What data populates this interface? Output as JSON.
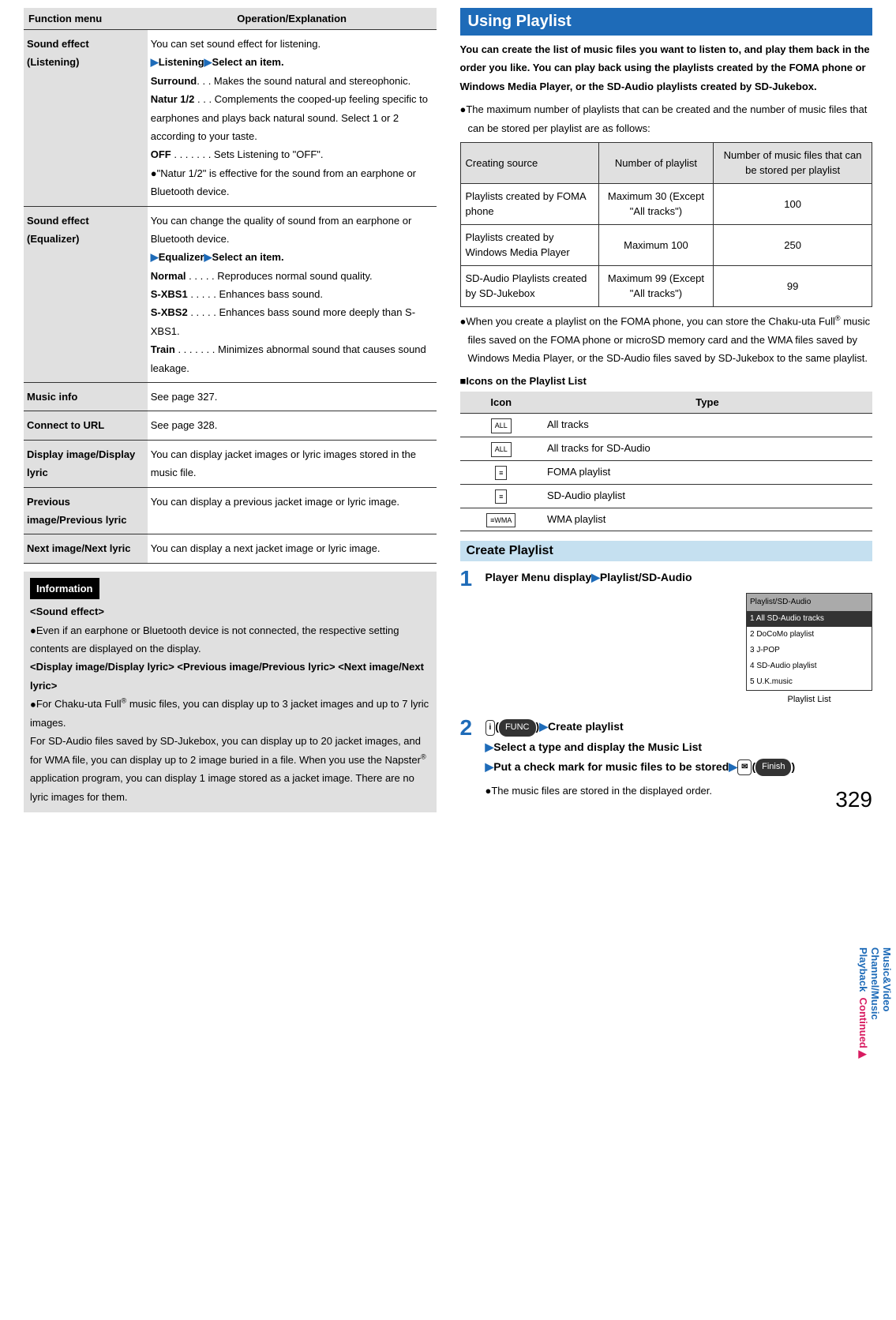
{
  "func_header_menu": "Function menu",
  "func_header_op": "Operation/Explanation",
  "rows": {
    "r1_menu": "Sound effect (Listening)",
    "r1_intro": "You can set sound effect for listening.",
    "r1_link": "Listening",
    "r1_sel": "Select an item.",
    "r1_surround_k": "Surround",
    "r1_surround_v": ". . . Makes the sound natural and stereophonic.",
    "r1_natur_k": "Natur 1/2",
    "r1_natur_v": " . . . Complements the cooped-up feeling specific to earphones and plays back natural sound. Select 1 or 2 according to your taste.",
    "r1_off_k": "OFF",
    "r1_off_v": " . . . . . . . Sets Listening to \"OFF\".",
    "r1_note": "\"Natur 1/2\" is effective for the sound from an earphone or Bluetooth device.",
    "r2_menu": "Sound effect (Equalizer)",
    "r2_intro": "You can change the quality of sound from an earphone or Bluetooth device.",
    "r2_link": "Equalizer",
    "r2_sel": "Select an item.",
    "r2_normal_k": "Normal",
    "r2_normal_v": " . . . . . Reproduces normal sound quality.",
    "r2_sxbs1_k": "S-XBS1",
    "r2_sxbs1_v": " . . . . . Enhances bass sound.",
    "r2_sxbs2_k": "S-XBS2",
    "r2_sxbs2_v": " . . . . . Enhances bass sound more deeply than S-XBS1.",
    "r2_train_k": "Train",
    "r2_train_v": " . . . . . . . Minimizes abnormal sound that causes sound leakage.",
    "r3_menu": "Music info",
    "r3_op": "See page 327.",
    "r4_menu": "Connect to URL",
    "r4_op": "See page 328.",
    "r5_menu": "Display image/Display lyric",
    "r5_op": "You can display jacket images or lyric images stored in the music file.",
    "r6_menu": "Previous image/Previous lyric",
    "r6_op": "You can display a previous jacket image or lyric image.",
    "r7_menu": "Next image/Next lyric",
    "r7_op": "You can display a next jacket image or lyric image."
  },
  "info": {
    "label": "Information",
    "h1": "<Sound effect>",
    "p1": "Even if an earphone or Bluetooth device is not connected, the respective setting contents are displayed on the display.",
    "h2": "<Display image/Display lyric> <Previous image/Previous lyric> <Next image/Next lyric>",
    "p2a": "For Chaku-uta Full",
    "p2b": " music files, you can display up to 3 jacket images and up to 7 lyric images.",
    "p2c": "For SD-Audio files saved by SD-Jukebox, you can display up to 20 jacket images, and for WMA file, you can display up to 2 image buried in a file. When you use the Napster",
    "p2d": " application program, you can display 1 image stored as a jacket image. There are no lyric images for them."
  },
  "section_title": "Using Playlist",
  "intro": "You can create the list of music files you want to listen to, and play them back in the order you like. You can play back using the playlists created by the FOMA phone or Windows Media Player, or the SD-Audio playlists created by SD-Jukebox.",
  "bullet1": "The maximum number of playlists that can be created and the number of music files that can be stored per playlist are as follows:",
  "ptable": {
    "h1": "Creating source",
    "h2": "Number of playlist",
    "h3": "Number of music files that can be stored per playlist",
    "r1c1": "Playlists created by FOMA phone",
    "r1c2": "Maximum 30 (Except \"All tracks\")",
    "r1c3": "100",
    "r2c1": "Playlists created by Windows Media Player",
    "r2c2": "Maximum 100",
    "r2c3": "250",
    "r3c1": "SD-Audio Playlists created by SD-Jukebox",
    "r3c2": "Maximum 99 (Except \"All tracks\")",
    "r3c3": "99"
  },
  "bullet2a": "When you create a playlist on the FOMA phone, you can store the Chaku-uta Full",
  "bullet2b": " music files saved on the FOMA phone or microSD memory card and the WMA files saved by Windows Media Player, or the SD-Audio files saved by SD-Jukebox to the same playlist.",
  "icons_head": "■Icons on the Playlist List",
  "itable": {
    "h1": "Icon",
    "h2": "Type",
    "r1i": "ALL",
    "r1t": "All tracks",
    "r2i": "ALL",
    "r2t": "All tracks for SD-Audio",
    "r3i": "≡",
    "r3t": "FOMA playlist",
    "r4i": "≡",
    "r4t": "SD-Audio playlist",
    "r5i": "≡WMA",
    "r5t": "WMA playlist"
  },
  "create_title": "Create Playlist",
  "step1_num": "1",
  "step1_text": "Player Menu display",
  "step1_link": "Playlist/SD-Audio",
  "shot": {
    "hdr": "Playlist/SD-Audio",
    "r1": "1 All SD-Audio tracks",
    "r2": "2 DoCoMo playlist",
    "r3": "3 J-POP",
    "r4": "4 SD-Audio playlist",
    "r5": "5 U.K.music",
    "caption": "Playlist List"
  },
  "step2_num": "2",
  "step2_key1": "i",
  "step2_func": "FUNC",
  "step2_t1": "Create playlist",
  "step2_t2": "Select a type and display the Music List",
  "step2_t3": "Put a check mark for music files to be stored",
  "step2_key2": "✉",
  "step2_finish": "Finish",
  "step2_note": "The music files are stored in the displayed order.",
  "side_tab": "Music&Video Channel/Music Playback",
  "continued": "Continued",
  "page_num": "329"
}
